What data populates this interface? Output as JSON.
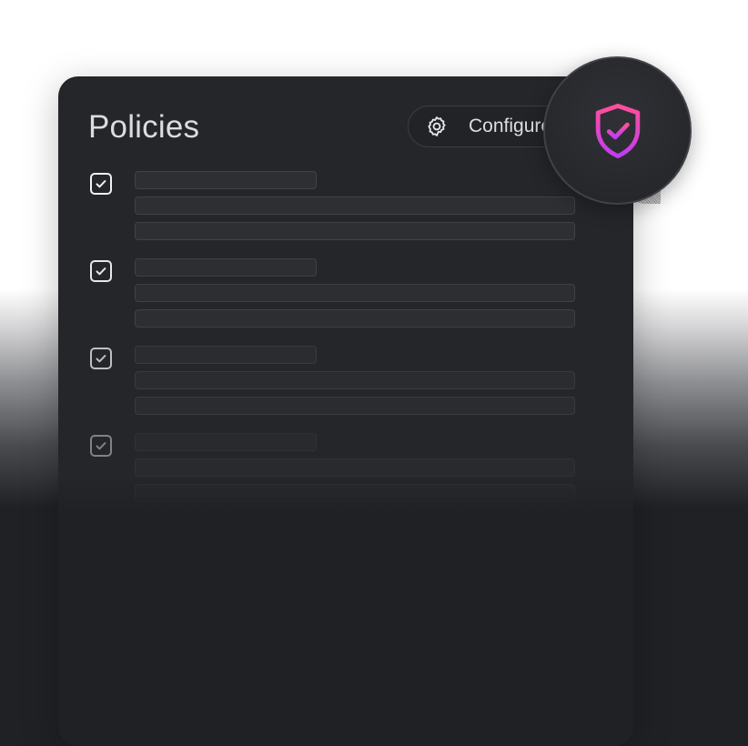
{
  "panel": {
    "title": "Policies",
    "configure_label": "Configure"
  },
  "icons": {
    "config": "gear-icon",
    "badge": "shield-check-icon",
    "checkbox": "checkmark-icon"
  },
  "colors": {
    "badge_gradient_start": "#ff4f9a",
    "badge_gradient_end": "#c13cf2",
    "panel_background": "#25262a",
    "page_background": "#202124"
  },
  "policies": [
    {
      "checked": true
    },
    {
      "checked": true
    },
    {
      "checked": true
    },
    {
      "checked": true
    }
  ]
}
